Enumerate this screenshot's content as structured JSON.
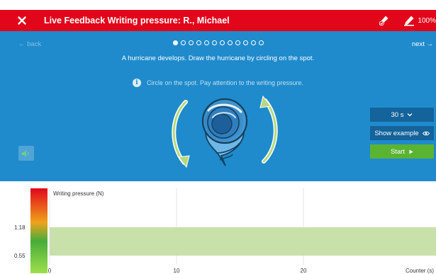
{
  "header": {
    "title": "Live Feedback Writing pressure: R., Michael",
    "battery": "100%",
    "close_icon": "close-icon",
    "pen_check_icon": "pen-check-icon",
    "pen_battery_icon": "pen-battery-icon",
    "color": "#e2061b"
  },
  "task": {
    "back_label": "← back",
    "next_label": "next →",
    "pagination": {
      "total": 12,
      "current": 1
    },
    "instruction": "A hurricane develops. Draw the hurricane by circling on the spot.",
    "hint": "Circle on the spot. Pay attention to the writing pressure.",
    "info_icon": "i",
    "duration": "30 s",
    "show_example_label": "Show example",
    "start_label": "Start",
    "sound_icon": "speaker-icon",
    "color": "#1f8bcc"
  },
  "chart_data": {
    "type": "area",
    "ylabel": "Writing pressure (N)",
    "xlabel": "Counter (s)",
    "x_ticks": [
      0,
      10,
      20
    ],
    "y_ticks": [
      0.55,
      1.18
    ],
    "xlim": [
      0,
      30
    ],
    "target_band": {
      "from": 0.55,
      "to": 1.18,
      "color": "#c8e0aa"
    },
    "series": [],
    "grid": true
  }
}
